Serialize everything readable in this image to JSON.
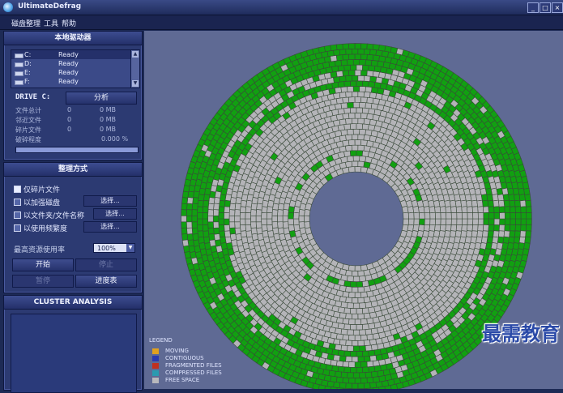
{
  "window": {
    "title": "UltimateDefrag"
  },
  "menu": [
    "磁盘整理",
    "工具",
    "帮助"
  ],
  "drives_panel": {
    "header": "本地驱动器",
    "drives": [
      {
        "letter": "C:",
        "status": "Ready"
      },
      {
        "letter": "D:",
        "status": "Ready"
      },
      {
        "letter": "E:",
        "status": "Ready"
      },
      {
        "letter": "F:",
        "status": "Ready"
      }
    ],
    "drive_label": "DRIVE C:",
    "analyze_button": "分析",
    "stats": [
      {
        "label": "文件总计",
        "count": "0",
        "size": "0 MB"
      },
      {
        "label": "邻近文件",
        "count": "0",
        "size": "0 MB"
      },
      {
        "label": "碎片文件",
        "count": "0",
        "size": "0 MB"
      }
    ],
    "frag_label": "破碎程度",
    "frag_value": "0.000 %",
    "progress": 0
  },
  "method_panel": {
    "header": "整理方式",
    "options": [
      {
        "label": "仅碎片文件",
        "checked": true,
        "select": ""
      },
      {
        "label": "以加强磁盘",
        "checked": false,
        "select": "选择..."
      },
      {
        "label": "以文件夹/文件名称",
        "checked": false,
        "select": "选择..."
      },
      {
        "label": "以使用频繁度",
        "checked": false,
        "select": "选择..."
      }
    ],
    "max_resource_label": "最高资源使用率",
    "max_resource_value": "100%",
    "start_button": "开始",
    "stop_button": "停止",
    "pause_button": "暂停",
    "progress_button": "进度表"
  },
  "cluster_panel": {
    "header": "CLUSTER ANALYSIS"
  },
  "legend": {
    "title": "LEGEND",
    "items": [
      {
        "label": "MOVING",
        "color": "#e0a020"
      },
      {
        "label": "CONTIGUOUS",
        "color": "#2a3ab0"
      },
      {
        "label": "FRAGMENTED FILES",
        "color": "#c03020"
      },
      {
        "label": "COMPRESSED FILES",
        "color": "#2a9ab0"
      },
      {
        "label": "FREE SPACE",
        "color": "#b8b8bc"
      }
    ]
  },
  "colors": {
    "used": "#11a011",
    "free": "#b4b4b8",
    "grid": "#3a4a3a",
    "map_bg": "#5f6a94"
  },
  "watermark": "最需教育"
}
